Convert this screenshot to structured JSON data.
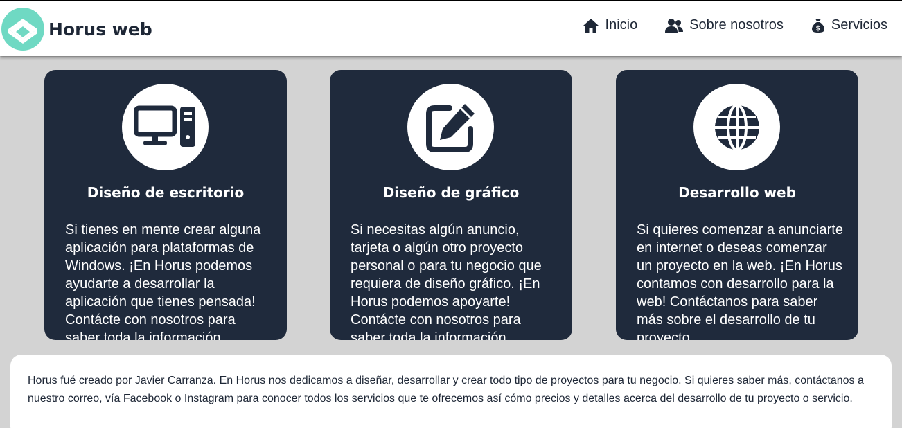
{
  "brand": {
    "name": "Horus web",
    "logo_color": "#6fd9c3"
  },
  "nav": [
    {
      "label": "Inicio",
      "icon": "home-icon"
    },
    {
      "label": "Sobre nosotros",
      "icon": "users-icon"
    },
    {
      "label": "Servicios",
      "icon": "money-bag-icon"
    }
  ],
  "cards": [
    {
      "icon": "desktop-computer-icon",
      "title": "Diseño de escritorio",
      "text": "Si tienes en mente crear alguna aplicación para plataformas de Windows. ¡En Horus podemos ayudarte a desarrollar la aplicación que tienes pensada! Contácte con nosotros para saber toda la información."
    },
    {
      "icon": "edit-pen-icon",
      "title": "Diseño de gráfico",
      "text": "Si necesitas algún anuncio, tarjeta o algún otro proyecto personal o para tu negocio que requiera de diseño gráfico. ¡En Horus podemos apoyarte! Contácte con nosotros para saber toda la información."
    },
    {
      "icon": "globe-icon",
      "title": "Desarrollo web",
      "text": "Si quieres comenzar a anunciarte en internet o deseas comenzar un proyecto en la web. ¡En Horus contamos con desarrollo para la web! Contáctanos para saber más sobre el desarrollo de tu proyecto."
    }
  ],
  "about": {
    "text": "Horus fué creado por Javier Carranza. En Horus nos dedicamos a diseñar, desarrollar y crear todo tipo de proyectos para tu negocio. Si quieres saber más, contáctanos a nuestro correo, vía Facebook o Instagram para conocer todos los servicios que te ofrecemos así cómo precios y detalles acerca del desarrollo de tu proyecto o servicio."
  },
  "colors": {
    "dark": "#1f2a3c",
    "background": "#d3d3d3",
    "accent": "#6fd9c3"
  }
}
